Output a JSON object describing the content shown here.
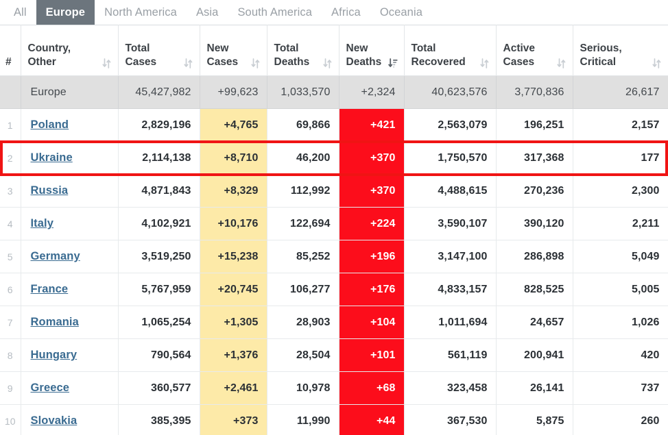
{
  "tabs": [
    {
      "label": "All",
      "active": false
    },
    {
      "label": "Europe",
      "active": true
    },
    {
      "label": "North America",
      "active": false
    },
    {
      "label": "Asia",
      "active": false
    },
    {
      "label": "South America",
      "active": false
    },
    {
      "label": "Africa",
      "active": false
    },
    {
      "label": "Oceania",
      "active": false
    }
  ],
  "columns": [
    {
      "key": "num",
      "line1": "",
      "line2": "#",
      "sort": "none",
      "icon": "sort-both-icon"
    },
    {
      "key": "country",
      "line1": "Country,",
      "line2": "Other",
      "sort": "none",
      "icon": "sort-both-icon"
    },
    {
      "key": "totalcases",
      "line1": "Total",
      "line2": "Cases",
      "sort": "none",
      "icon": "sort-both-icon"
    },
    {
      "key": "newcases",
      "line1": "New",
      "line2": "Cases",
      "sort": "none",
      "icon": "sort-both-icon"
    },
    {
      "key": "totaldeaths",
      "line1": "Total",
      "line2": "Deaths",
      "sort": "none",
      "icon": "sort-both-icon"
    },
    {
      "key": "newdeaths",
      "line1": "New",
      "line2": "Deaths",
      "sort": "desc",
      "icon": "sort-desc-icon"
    },
    {
      "key": "totalrec",
      "line1": "Total",
      "line2": "Recovered",
      "sort": "none",
      "icon": "sort-both-icon"
    },
    {
      "key": "activecases",
      "line1": "Active",
      "line2": "Cases",
      "sort": "none",
      "icon": "sort-both-icon"
    },
    {
      "key": "seriouscrit",
      "line1": "Serious,",
      "line2": "Critical",
      "sort": "none",
      "icon": "sort-both-icon"
    }
  ],
  "total_row": {
    "num": "",
    "country": "Europe",
    "totalcases": "45,427,982",
    "newcases": "+99,623",
    "totaldeaths": "1,033,570",
    "newdeaths": "+2,324",
    "totalrec": "40,623,576",
    "activecases": "3,770,836",
    "seriouscrit": "26,617"
  },
  "rows": [
    {
      "num": "1",
      "country": "Poland",
      "totalcases": "2,829,196",
      "newcases": "+4,765",
      "totaldeaths": "69,866",
      "newdeaths": "+421",
      "totalrec": "2,563,079",
      "activecases": "196,251",
      "seriouscrit": "2,157",
      "highlighted": false
    },
    {
      "num": "2",
      "country": "Ukraine",
      "totalcases": "2,114,138",
      "newcases": "+8,710",
      "totaldeaths": "46,200",
      "newdeaths": "+370",
      "totalrec": "1,750,570",
      "activecases": "317,368",
      "seriouscrit": "177",
      "highlighted": true
    },
    {
      "num": "3",
      "country": "Russia",
      "totalcases": "4,871,843",
      "newcases": "+8,329",
      "totaldeaths": "112,992",
      "newdeaths": "+370",
      "totalrec": "4,488,615",
      "activecases": "270,236",
      "seriouscrit": "2,300",
      "highlighted": false
    },
    {
      "num": "4",
      "country": "Italy",
      "totalcases": "4,102,921",
      "newcases": "+10,176",
      "totaldeaths": "122,694",
      "newdeaths": "+224",
      "totalrec": "3,590,107",
      "activecases": "390,120",
      "seriouscrit": "2,211",
      "highlighted": false
    },
    {
      "num": "5",
      "country": "Germany",
      "totalcases": "3,519,250",
      "newcases": "+15,238",
      "totaldeaths": "85,252",
      "newdeaths": "+196",
      "totalrec": "3,147,100",
      "activecases": "286,898",
      "seriouscrit": "5,049",
      "highlighted": false
    },
    {
      "num": "6",
      "country": "France",
      "totalcases": "5,767,959",
      "newcases": "+20,745",
      "totaldeaths": "106,277",
      "newdeaths": "+176",
      "totalrec": "4,833,157",
      "activecases": "828,525",
      "seriouscrit": "5,005",
      "highlighted": false
    },
    {
      "num": "7",
      "country": "Romania",
      "totalcases": "1,065,254",
      "newcases": "+1,305",
      "totaldeaths": "28,903",
      "newdeaths": "+104",
      "totalrec": "1,011,694",
      "activecases": "24,657",
      "seriouscrit": "1,026",
      "highlighted": false
    },
    {
      "num": "8",
      "country": "Hungary",
      "totalcases": "790,564",
      "newcases": "+1,376",
      "totaldeaths": "28,504",
      "newdeaths": "+101",
      "totalrec": "561,119",
      "activecases": "200,941",
      "seriouscrit": "420",
      "highlighted": false
    },
    {
      "num": "9",
      "country": "Greece",
      "totalcases": "360,577",
      "newcases": "+2,461",
      "totaldeaths": "10,978",
      "newdeaths": "+68",
      "totalrec": "323,458",
      "activecases": "26,141",
      "seriouscrit": "737",
      "highlighted": false
    },
    {
      "num": "10",
      "country": "Slovakia",
      "totalcases": "385,395",
      "newcases": "+373",
      "totaldeaths": "11,990",
      "newdeaths": "+44",
      "totalrec": "367,530",
      "activecases": "5,875",
      "seriouscrit": "260",
      "highlighted": false
    }
  ],
  "colors": {
    "active_tab_bg": "#6c757d",
    "new_cases_bg": "#fdeaa8",
    "new_deaths_bg": "#fc0d1b",
    "total_row_bg": "#e0e0e0",
    "highlight_border": "#f01414",
    "country_link": "#3a6b91"
  }
}
